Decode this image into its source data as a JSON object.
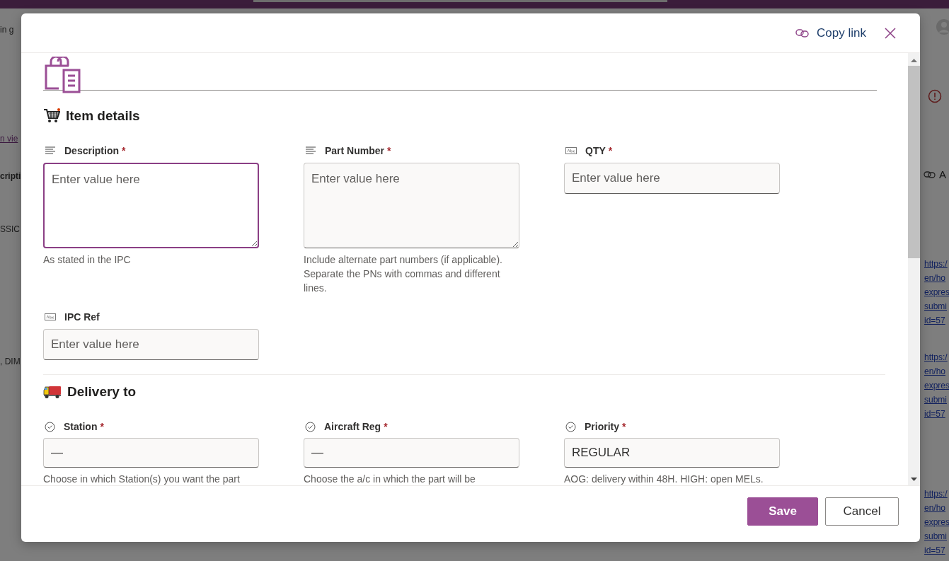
{
  "background": {
    "left_texts": [
      {
        "text": "in g",
        "kind": "plain"
      },
      {
        "text": "n vie",
        "kind": "link"
      },
      {
        "text": "cripti",
        "kind": "header"
      },
      {
        "text": "SSIC",
        "kind": "plain"
      },
      {
        "text": ", DIM",
        "kind": "plain"
      }
    ],
    "right_header": "A",
    "right_links": [
      [
        "https:/",
        "en/ho",
        "expres",
        "submi",
        "id=57"
      ],
      [
        "https:/",
        "en/ho",
        "expres",
        "submi",
        "id=57"
      ],
      [
        "https:/",
        "en/ho",
        "expres",
        "submi",
        "id=57"
      ]
    ]
  },
  "dialog": {
    "copy_link": "Copy link",
    "sections": [
      {
        "title": "Item details",
        "kind": "cart",
        "fields": [
          {
            "label": "Description",
            "required_mark": "*",
            "kind": "multiline",
            "placeholder": "Enter value here",
            "focused": true,
            "help": "As stated in the IPC"
          },
          {
            "label": "Part Number",
            "required_mark": "*",
            "kind": "multiline",
            "placeholder": "Enter value here",
            "focused": false,
            "help": "Include alternate part numbers (if applicable). Separate the PNs with commas and different lines."
          },
          {
            "label": "QTY",
            "required_mark": "*",
            "kind": "text",
            "placeholder": "Enter value here",
            "focused": false
          },
          {
            "label": "IPC Ref",
            "kind": "text",
            "placeholder": "Enter value here",
            "focused": false
          }
        ]
      },
      {
        "title": "Delivery to",
        "kind": "truck",
        "fields": [
          {
            "label": "Station",
            "required_mark": "*",
            "kind": "choice",
            "value": "—",
            "focused": false,
            "help": "Choose in which Station(s) you want the part"
          },
          {
            "label": "Aircraft Reg",
            "required_mark": "*",
            "kind": "choice",
            "value": "—",
            "focused": false,
            "help": "Choose the a/c in which the part will be"
          },
          {
            "label": "Priority",
            "required_mark": "*",
            "kind": "choice",
            "value": "REGULAR",
            "focused": false,
            "help": "AOG: delivery within 48H. HIGH: open MELs."
          }
        ]
      }
    ],
    "buttons": [
      {
        "label": "Save",
        "kind": "primary"
      },
      {
        "label": "Cancel",
        "kind": "secondary"
      }
    ]
  }
}
